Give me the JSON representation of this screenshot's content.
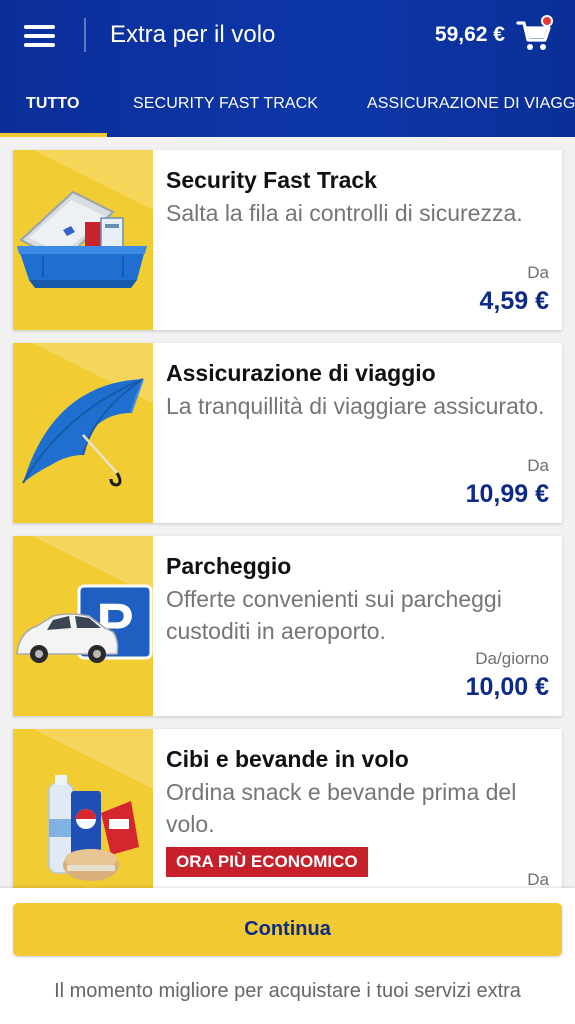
{
  "header": {
    "title": "Extra per il volo",
    "cart_total": "59,62 €",
    "menu_icon": "menu-icon",
    "cart_icon": "cart-icon"
  },
  "tabs": [
    {
      "label": "TUTTO",
      "active": true
    },
    {
      "label": "SECURITY FAST TRACK",
      "active": false
    },
    {
      "label": "ASSICURAZIONE DI VIAGGIO",
      "active": false
    }
  ],
  "products": [
    {
      "title": "Security Fast Track",
      "description": "Salta la fila ai controlli di sicurezza.",
      "price_label": "Da",
      "price": "4,59 €",
      "image_icon": "security-tray-icon"
    },
    {
      "title": "Assicurazione di viaggio",
      "description": "La tranquillità di viaggiare assicurato.",
      "price_label": "Da",
      "price": "10,99 €",
      "image_icon": "umbrella-icon"
    },
    {
      "title": "Parcheggio",
      "description": "Offerte convenienti sui parcheggi custoditi in aeroporto.",
      "price_label": "Da/giorno",
      "price": "10,00 €",
      "image_icon": "parking-icon"
    },
    {
      "title": "Cibi e bevande in volo",
      "description": "Ordina snack e bevande prima del volo.",
      "badge": "ORA PIÙ ECONOMICO",
      "price_label": "Da",
      "image_icon": "food-drinks-icon"
    }
  ],
  "footer": {
    "continue_label": "Continua",
    "hint": "Il momento migliore per acquistare i tuoi servizi extra"
  },
  "colors": {
    "primary_blue": "#0c36a8",
    "accent_yellow": "#f1c933",
    "price_blue": "#0c2a86",
    "badge_red": "#c6202b"
  }
}
